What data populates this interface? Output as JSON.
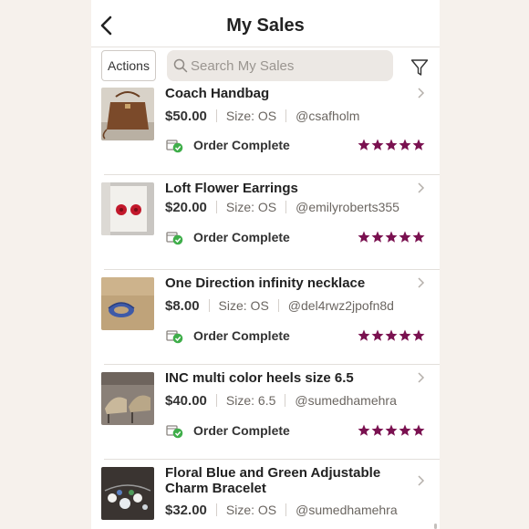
{
  "header": {
    "title": "My Sales"
  },
  "toolbar": {
    "actions_label": "Actions",
    "search_placeholder": "Search My Sales"
  },
  "colors": {
    "star": "#7a1150",
    "complete_badge": "#3fae4a",
    "accent": "#222222"
  },
  "icons": [
    "back-chevron-icon",
    "search-icon",
    "filter-icon",
    "chevron-right-icon",
    "order-complete-icon",
    "star-icon"
  ],
  "sales": [
    {
      "title": "Coach Handbag",
      "title_line2": "",
      "price": "$50.00",
      "size": "Size: OS",
      "buyer": "@csafholm",
      "status": "Order Complete",
      "rating": 5,
      "thumbnail": "brown-handbag"
    },
    {
      "title": "Loft Flower Earrings",
      "title_line2": "",
      "price": "$20.00",
      "size": "Size: OS",
      "buyer": "@emilyroberts355",
      "status": "Order Complete",
      "rating": 5,
      "thumbnail": "red-flower-earrings"
    },
    {
      "title": "One Direction infinity necklace",
      "title_line2": "",
      "price": "$8.00",
      "size": "Size: OS",
      "buyer": "@del4rwz2jpofn8d",
      "status": "Order Complete",
      "rating": 5,
      "thumbnail": "blue-necklace"
    },
    {
      "title": "INC multi color heels size 6.5",
      "title_line2": "",
      "price": "$40.00",
      "size": "Size: 6.5",
      "buyer": "@sumedhamehra",
      "status": "Order Complete",
      "rating": 5,
      "thumbnail": "heels"
    },
    {
      "title": "Floral Blue and Green Adjustable",
      "title_line2": "Charm Bracelet",
      "price": "$32.00",
      "size": "Size: OS",
      "buyer": "@sumedhamehra",
      "status": "",
      "rating": 0,
      "thumbnail": "charm-bracelet"
    }
  ]
}
